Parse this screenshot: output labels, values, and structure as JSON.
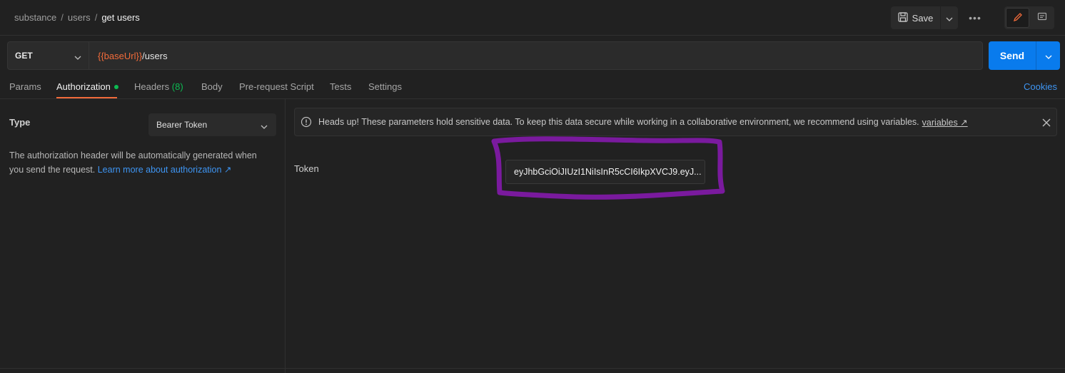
{
  "breadcrumb": {
    "items": [
      "substance",
      "users"
    ],
    "separator": "/",
    "current": "get users"
  },
  "toolbar": {
    "save_label": "Save",
    "more_label": "•••"
  },
  "request": {
    "method": "GET",
    "url_variable": "{{baseUrl}}",
    "url_path": "/users",
    "send_label": "Send"
  },
  "tabs": [
    {
      "label": "Params"
    },
    {
      "label": "Authorization",
      "active": true
    },
    {
      "label": "Headers",
      "count": "(8)"
    },
    {
      "label": "Body"
    },
    {
      "label": "Pre-request Script"
    },
    {
      "label": "Tests"
    },
    {
      "label": "Settings"
    }
  ],
  "cookies_label": "Cookies",
  "auth": {
    "type_label": "Type",
    "type_value": "Bearer Token",
    "description": "The authorization header will be automatically generated when you send the request.",
    "learn_more": "Learn more about authorization ↗"
  },
  "alert": {
    "text": "Heads up! These parameters hold sensitive data. To keep this data secure while working in a collaborative environment, we recommend using variables.",
    "link": "variables ↗"
  },
  "token": {
    "label": "Token",
    "value": "eyJhbGciOiJIUzI1NiIsInR5cCI6IkpXVCJ9.eyJ..."
  },
  "colors": {
    "accent": "#f26b3a",
    "send": "#097bed",
    "link": "#3e95f3",
    "status_dot": "#0cbb52",
    "highlight": "#7a1a9e"
  }
}
